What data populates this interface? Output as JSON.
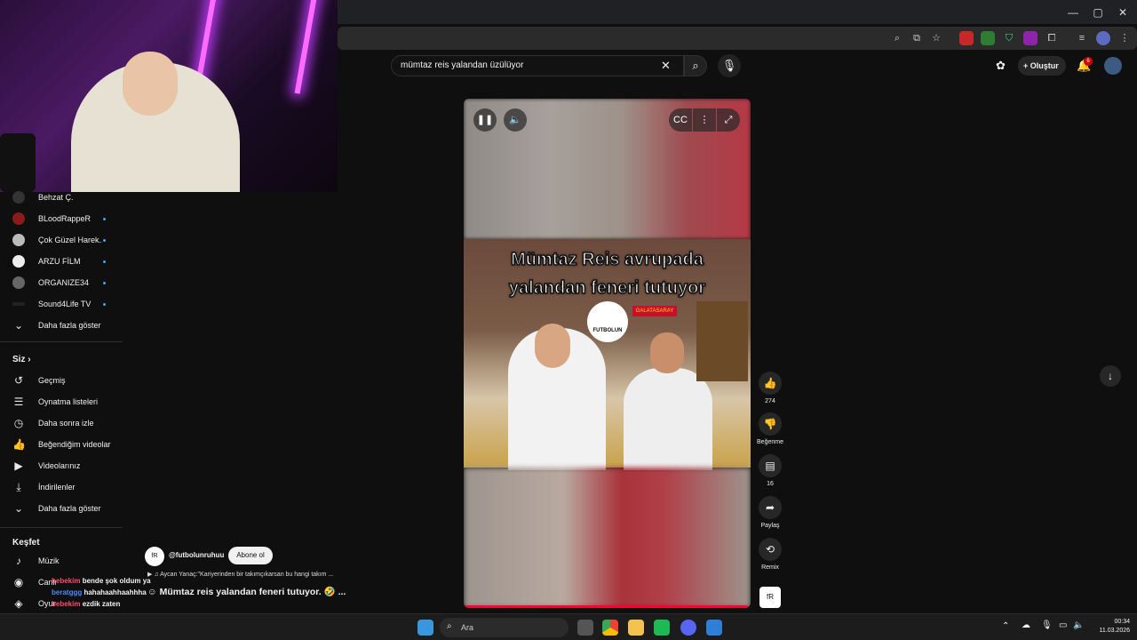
{
  "search": {
    "query": "mümtaz reis yalandan üzülüyor"
  },
  "header": {
    "create_label": "Oluştur",
    "notif_count": "6"
  },
  "subscriptions": [
    {
      "label": "Behzat Ç.",
      "badge": ""
    },
    {
      "label": "BLoodRappeR",
      "badge": ""
    },
    {
      "label": "Çok Güzel Harek...",
      "badge": ""
    },
    {
      "label": "ARZU FİLM",
      "badge": ""
    },
    {
      "label": "ORGANIZE34",
      "badge": ""
    },
    {
      "label": "Sound4Life TV",
      "badge": ""
    }
  ],
  "show_more_1": "Daha fazla göster",
  "you": {
    "title": "Siz",
    "items": [
      {
        "label": "Geçmiş",
        "icon": "history-icon"
      },
      {
        "label": "Oynatma listeleri",
        "icon": "playlist-icon"
      },
      {
        "label": "Daha sonra izle",
        "icon": "clock-icon"
      },
      {
        "label": "Beğendiğim videolar",
        "icon": "thumbs-up-icon"
      },
      {
        "label": "Videolarınız",
        "icon": "video-icon"
      },
      {
        "label": "İndirilenler",
        "icon": "download-icon"
      }
    ],
    "show_more": "Daha fazla göster"
  },
  "explore": {
    "title": "Keşfet",
    "items": [
      {
        "label": "Müzik",
        "icon": "music-icon"
      },
      {
        "label": "Canlı",
        "icon": "live-icon"
      },
      {
        "label": "Oyun",
        "icon": "gaming-icon"
      }
    ]
  },
  "video": {
    "overlay_line1": "Mümtaz Reis avrupada",
    "overlay_line2": "yalandan feneri tutuyor",
    "logo_text": "FUTBOLUN",
    "banner_text": "GALATASARAY",
    "progress": 0.99
  },
  "actions": {
    "likes": "274",
    "dislike_label": "Beğenme",
    "comments": "16",
    "share_label": "Paylaş",
    "remix_label": "Remix"
  },
  "channel": {
    "handle": "@futbolunruhuu",
    "subscribe_label": "Abone ol"
  },
  "music_line": "Aycan Yanaç:\"Kariyerinden bir takımçıkarsan bu hangi takım ...",
  "short_title": "Mümtaz reis yalandan feneri tutuyor. 🤣 ...",
  "chat": [
    {
      "user": "bebekim",
      "msg": "bende şok oldum ya",
      "color": "#ff4d6d"
    },
    {
      "user": "beratggg",
      "msg": "hahahaahhaahhha",
      "color": "#4d8bff"
    },
    {
      "user": "bebekim",
      "msg": "ezdik zaten",
      "color": "#ff4d6d"
    }
  ],
  "taskbar": {
    "search_placeholder": "Ara",
    "time": "00:34",
    "date": "11.03.2026"
  },
  "colors": {
    "accent": "#3ea6ff",
    "notif": "#cc0000",
    "progress": "#ff0033"
  }
}
